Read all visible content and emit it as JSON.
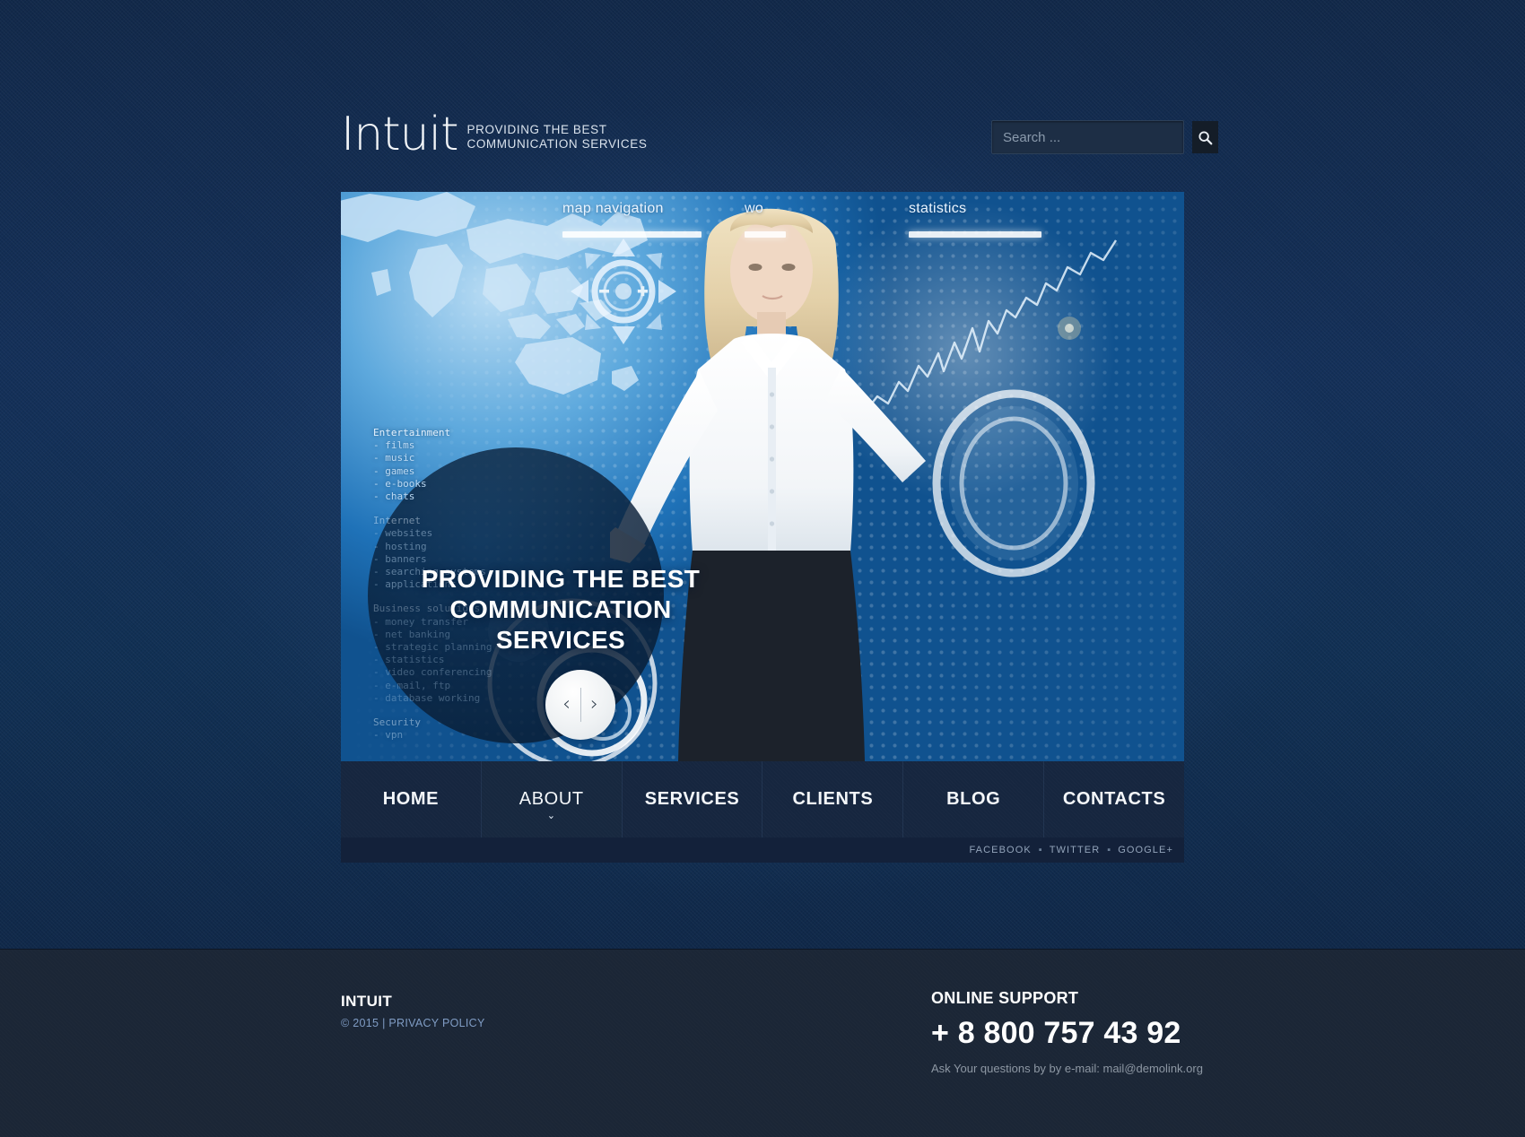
{
  "site": {
    "logo": "Intuit",
    "tagline_line1": "PROVIDING THE BEST",
    "tagline_line2": "COMMUNICATION SERVICES"
  },
  "search": {
    "placeholder": "Search ...",
    "value": "",
    "icon": "search-icon"
  },
  "hero": {
    "labels": [
      {
        "text": "map navigation"
      },
      {
        "text": "wo"
      },
      {
        "text": "statistics"
      }
    ],
    "caption_line1": "PROVIDING THE BEST",
    "caption_line2": "COMMUNICATION",
    "caption_line3": "SERVICES",
    "prev_arrow": "‹",
    "next_arrow": "›",
    "service_groups": [
      {
        "title": "Entertainment",
        "items": [
          "films",
          "music",
          "games",
          "e-books",
          "chats"
        ]
      },
      {
        "title": "Internet",
        "items": [
          "websites",
          "hosting",
          "banners",
          "searching systems",
          "applications"
        ]
      },
      {
        "title": "Business solutions",
        "items": [
          "money transfer",
          "net banking",
          "strategic planning",
          "statistics",
          "video conferencing",
          "e-mail, ftp",
          "database working"
        ]
      },
      {
        "title": "Security",
        "items": [
          "vpn"
        ]
      }
    ]
  },
  "nav": {
    "items": [
      {
        "label": "HOME",
        "active": false,
        "has_dropdown": false
      },
      {
        "label": "ABOUT",
        "active": true,
        "has_dropdown": true
      },
      {
        "label": "SERVICES",
        "active": false,
        "has_dropdown": false
      },
      {
        "label": "CLIENTS",
        "active": false,
        "has_dropdown": false
      },
      {
        "label": "BLOG",
        "active": false,
        "has_dropdown": false
      },
      {
        "label": "CONTACTS",
        "active": false,
        "has_dropdown": false
      }
    ],
    "dropdown_chevron": "⌄"
  },
  "social": {
    "separator": "▪",
    "links": [
      "FACEBOOK",
      "TWITTER",
      "GOOGLE+"
    ]
  },
  "footer": {
    "brand": "INTUIT",
    "copyright": "© 2015 | ",
    "privacy_label": "PRIVACY POLICY",
    "support_title": "ONLINE SUPPORT",
    "phone": "+ 8 800 757 43 92",
    "ask": "Ask Your questions by by e-mail: mail@demolink.org"
  },
  "colors": {
    "page_bg": "#13294a",
    "nav_bg": "#16263f",
    "footer_bg": "#1b2636",
    "accent_blue": "#1570b9",
    "link_blue": "#7f9cc4"
  }
}
